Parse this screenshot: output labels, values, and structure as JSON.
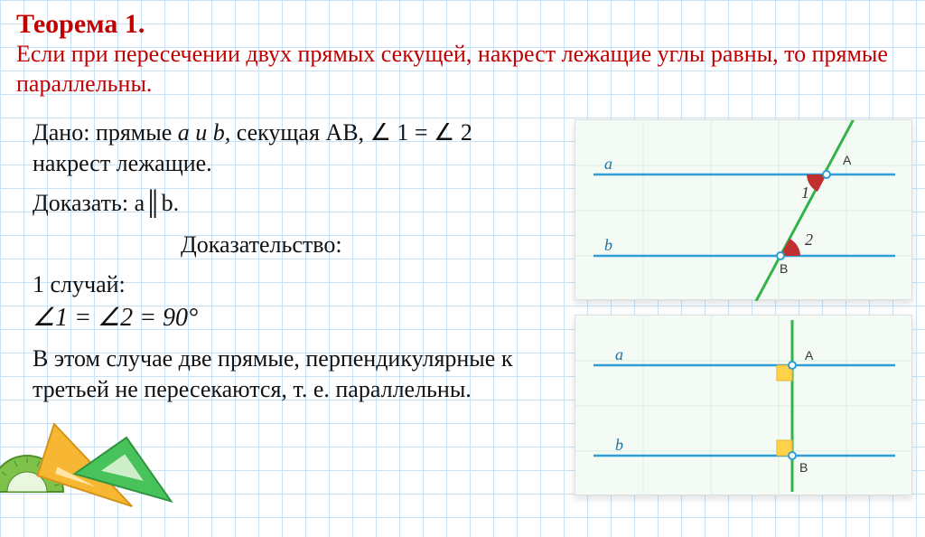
{
  "title": "Теорема 1.",
  "statement": "Если при пересечении двух прямых секущей, накрест лежащие углы равны, то прямые параллельны.",
  "given_prefix": "Дано: прямые ",
  "given_lines": "a и b,",
  "given_secant": " секущая AB, ",
  "given_angles": "∠ 1 = ∠ 2 накрест лежащие.",
  "prove_prefix": "Доказать: ",
  "prove_expr": "a║b.",
  "proof_header": "Доказательство:",
  "case1_label": "1 случай:",
  "case1_eq": "∠1 = ∠2 = 90°",
  "case1_text": "В этом случае две прямые, перпендикулярные к третьей не пересекаются, т. е. параллельны.",
  "fig1": {
    "line_a": "a",
    "line_b": "b",
    "ptA": "A",
    "ptB": "B",
    "ang1": "1",
    "ang2": "2"
  },
  "fig2": {
    "line_a": "a",
    "line_b": "b",
    "ptA": "A",
    "ptB": "B"
  }
}
